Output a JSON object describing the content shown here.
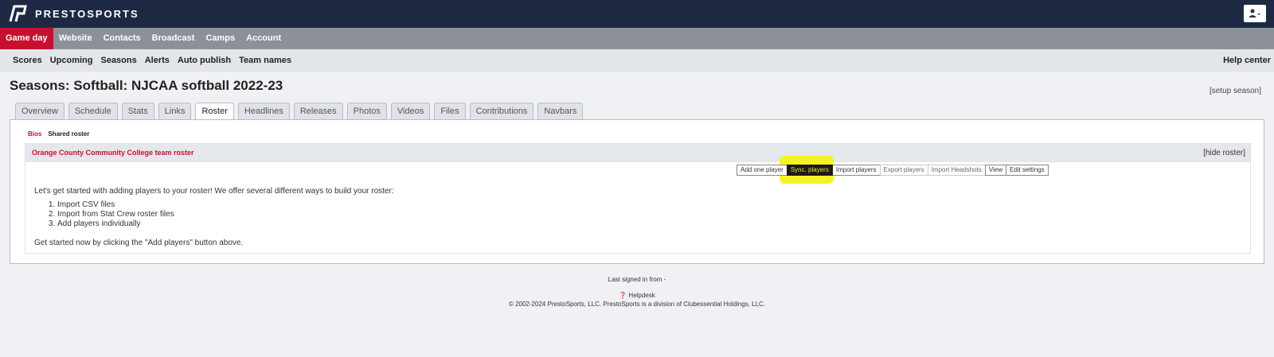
{
  "brand": {
    "name": "PRESTOSPORTS"
  },
  "main_nav": [
    "Game day",
    "Website",
    "Contacts",
    "Broadcast",
    "Camps",
    "Account"
  ],
  "sub_nav": [
    "Scores",
    "Upcoming",
    "Seasons",
    "Alerts",
    "Auto publish",
    "Team names"
  ],
  "help_center": "Help center",
  "page": {
    "title": "Seasons: Softball: NJCAA softball 2022-23",
    "setup_link": "[setup season]"
  },
  "tabs": [
    "Overview",
    "Schedule",
    "Stats",
    "Links",
    "Roster",
    "Headlines",
    "Releases",
    "Photos",
    "Videos",
    "Files",
    "Contributions",
    "Navbars"
  ],
  "active_tab": "Roster",
  "roster": {
    "subtabs": {
      "bios": "Bios",
      "shared": "Shared roster"
    },
    "title": "Orange County Community College team roster",
    "hide_link": "[hide roster]",
    "buttons": [
      "Add one player",
      "Sync. players",
      "Import players",
      "Export players",
      "Import Headshots",
      "View",
      "Edit settings"
    ],
    "intro": "Let's get started with adding players to your roster! We offer several different ways to build your roster:",
    "steps": [
      "Import CSV files",
      "Import from Stat Crew roster files",
      "Add players individually"
    ],
    "outro": "Get started now by clicking the \"Add players\" button above."
  },
  "footer": {
    "last_signed": "Last signed in from -",
    "helpdesk": "Helpdesk",
    "copyright": "© 2002-2024 PrestoSports, LLC. PrestoSports is a division of Clubessential Holdings, LLC."
  },
  "colors": {
    "topbar": "#1e2a44",
    "accent": "#c8102e",
    "highlight": "#f7f322"
  }
}
